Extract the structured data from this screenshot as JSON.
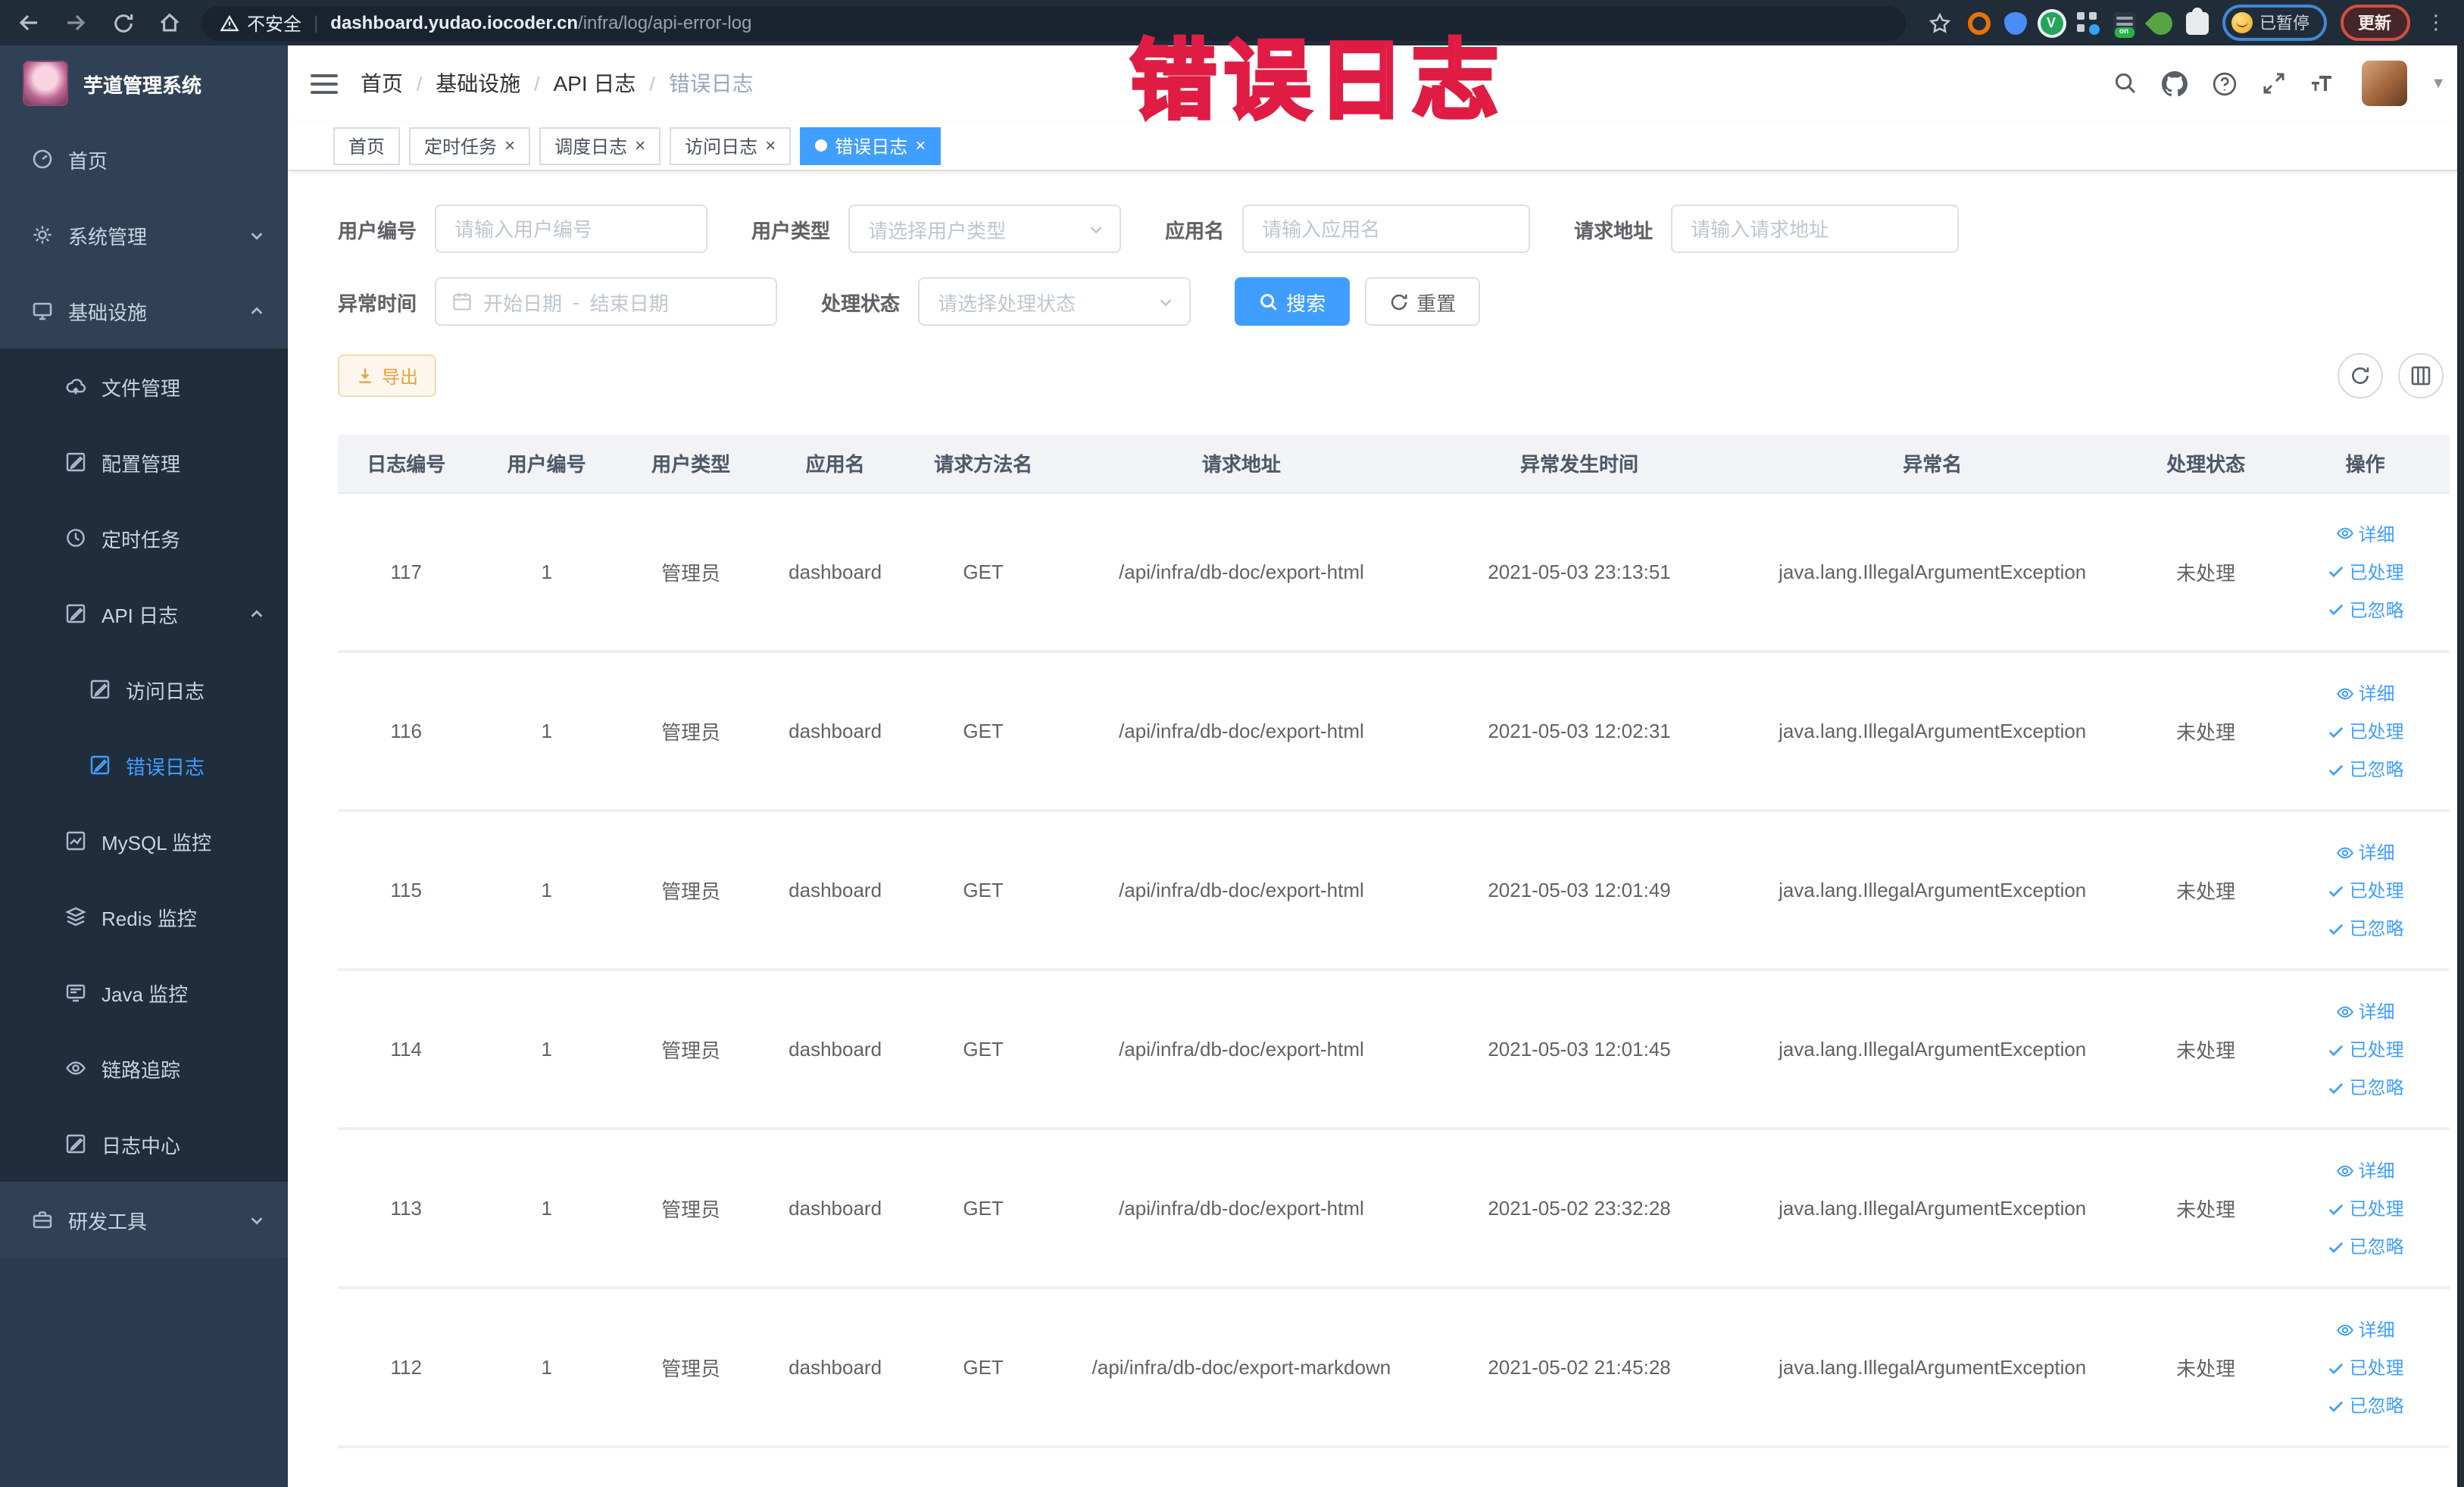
{
  "browser": {
    "security_label": "不安全",
    "url_host": "dashboard.yudao.iocoder.cn",
    "url_path": "/infra/log/api-error-log",
    "paused_label": "已暂停",
    "update_label": "更新"
  },
  "annotation": {
    "text": "错误日志",
    "color": "#e8234a"
  },
  "sidebar": {
    "title": "芋道管理系统",
    "items": [
      {
        "label": "首页"
      },
      {
        "label": "系统管理"
      },
      {
        "label": "基础设施"
      },
      {
        "label": "文件管理"
      },
      {
        "label": "配置管理"
      },
      {
        "label": "定时任务"
      },
      {
        "label": "API 日志"
      },
      {
        "label": "访问日志"
      },
      {
        "label": "错误日志"
      },
      {
        "label": "MySQL 监控"
      },
      {
        "label": "Redis 监控"
      },
      {
        "label": "Java 监控"
      },
      {
        "label": "链路追踪"
      },
      {
        "label": "日志中心"
      },
      {
        "label": "研发工具"
      }
    ]
  },
  "breadcrumb": [
    "首页",
    "基础设施",
    "API 日志",
    "错误日志"
  ],
  "tags": [
    {
      "label": "首页"
    },
    {
      "label": "定时任务"
    },
    {
      "label": "调度日志"
    },
    {
      "label": "访问日志"
    },
    {
      "label": "错误日志"
    }
  ],
  "filters": {
    "user_id": {
      "label": "用户编号",
      "placeholder": "请输入用户编号"
    },
    "user_type": {
      "label": "用户类型",
      "placeholder": "请选择用户类型"
    },
    "app_name": {
      "label": "应用名",
      "placeholder": "请输入应用名"
    },
    "request_url": {
      "label": "请求地址",
      "placeholder": "请输入请求地址"
    },
    "exception_time": {
      "label": "异常时间",
      "start_placeholder": "开始日期",
      "separator": "-",
      "end_placeholder": "结束日期"
    },
    "process_status": {
      "label": "处理状态",
      "placeholder": "请选择处理状态"
    },
    "search_label": "搜索",
    "reset_label": "重置"
  },
  "toolbar": {
    "export_label": "导出"
  },
  "table": {
    "columns": [
      "日志编号",
      "用户编号",
      "用户类型",
      "应用名",
      "请求方法名",
      "请求地址",
      "异常发生时间",
      "异常名",
      "处理状态",
      "操作"
    ],
    "row_actions": [
      "详细",
      "已处理",
      "已忽略"
    ],
    "rows": [
      {
        "id": "117",
        "user_id": "1",
        "user_type": "管理员",
        "app": "dashboard",
        "method": "GET",
        "url": "/api/infra/db-doc/export-html",
        "time": "2021-05-03 23:13:51",
        "exception": "java.lang.IllegalArgumentException",
        "status": "未处理"
      },
      {
        "id": "116",
        "user_id": "1",
        "user_type": "管理员",
        "app": "dashboard",
        "method": "GET",
        "url": "/api/infra/db-doc/export-html",
        "time": "2021-05-03 12:02:31",
        "exception": "java.lang.IllegalArgumentException",
        "status": "未处理"
      },
      {
        "id": "115",
        "user_id": "1",
        "user_type": "管理员",
        "app": "dashboard",
        "method": "GET",
        "url": "/api/infra/db-doc/export-html",
        "time": "2021-05-03 12:01:49",
        "exception": "java.lang.IllegalArgumentException",
        "status": "未处理"
      },
      {
        "id": "114",
        "user_id": "1",
        "user_type": "管理员",
        "app": "dashboard",
        "method": "GET",
        "url": "/api/infra/db-doc/export-html",
        "time": "2021-05-03 12:01:45",
        "exception": "java.lang.IllegalArgumentException",
        "status": "未处理"
      },
      {
        "id": "113",
        "user_id": "1",
        "user_type": "管理员",
        "app": "dashboard",
        "method": "GET",
        "url": "/api/infra/db-doc/export-html",
        "time": "2021-05-02 23:32:28",
        "exception": "java.lang.IllegalArgumentException",
        "status": "未处理"
      },
      {
        "id": "112",
        "user_id": "1",
        "user_type": "管理员",
        "app": "dashboard",
        "method": "GET",
        "url": "/api/infra/db-doc/export-markdown",
        "time": "2021-05-02 21:45:28",
        "exception": "java.lang.IllegalArgumentException",
        "status": "未处理"
      }
    ]
  }
}
